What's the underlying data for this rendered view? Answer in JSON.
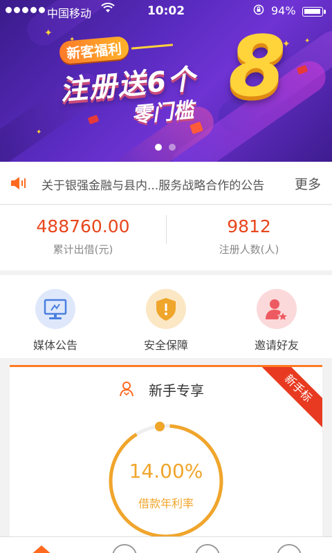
{
  "status_bar": {
    "carrier": "中国移动",
    "time": "10:02",
    "battery": "94%",
    "signal_bars": 5
  },
  "banner": {
    "tag": "新客福利",
    "headline1": "注册送6个",
    "headline2": "零门槛",
    "big_number": "8",
    "page_count": 2,
    "active_page": 0
  },
  "notice": {
    "text": "关于银强金融与县内...服务战略合作的公告",
    "more": "更多"
  },
  "stats": {
    "total_lent_value": "488760.00",
    "total_lent_label": "累计出借(元)",
    "users_value": "9812",
    "users_label": "注册人数(人)"
  },
  "actions": [
    {
      "label": "媒体公告",
      "icon": "monitor-icon",
      "color": "#dfe8fb",
      "icon_color": "#4a7fe0"
    },
    {
      "label": "安全保障",
      "icon": "shield-icon",
      "color": "#fbe7c4",
      "icon_color": "#f0a52b"
    },
    {
      "label": "邀请好友",
      "icon": "invite-friend-icon",
      "color": "#fbd9da",
      "icon_color": "#ee5a61"
    }
  ],
  "product": {
    "title": "新手专享",
    "ribbon": "新手标",
    "rate": "14.00%",
    "rate_label": "借款年利率",
    "accent": "#f0a52b"
  },
  "colors": {
    "accent_orange": "#ff6a1f",
    "value_red": "#e8461c"
  }
}
